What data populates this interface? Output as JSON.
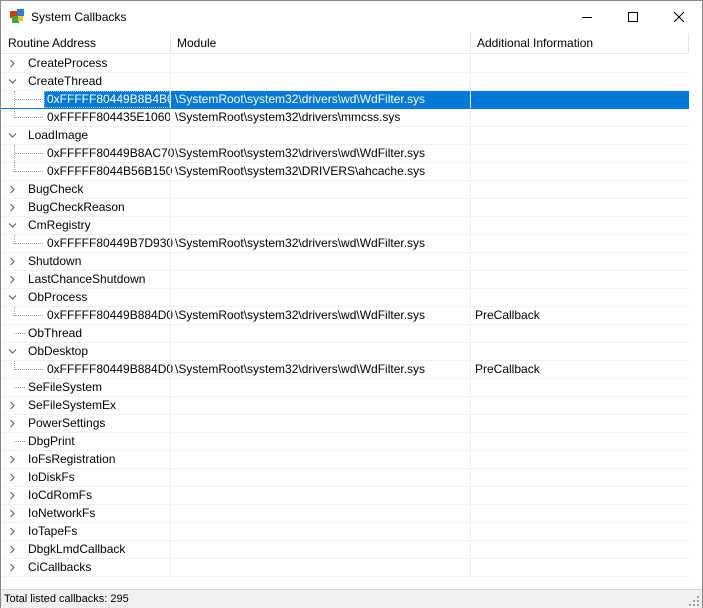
{
  "window": {
    "title": "System Callbacks"
  },
  "columns": [
    "Routine Address",
    "Module",
    "Additional Information"
  ],
  "rows": [
    {
      "kind": "parent",
      "expanded": false,
      "name": "CreateProcess",
      "module": "",
      "info": ""
    },
    {
      "kind": "parent",
      "expanded": true,
      "name": "CreateThread",
      "module": "",
      "info": ""
    },
    {
      "kind": "child",
      "selected": true,
      "name": "0xFFFFF80449B8B4B0",
      "module": "\\SystemRoot\\system32\\drivers\\wd\\WdFilter.sys",
      "info": ""
    },
    {
      "kind": "child",
      "last": true,
      "name": "0xFFFFF804435E1060",
      "module": "\\SystemRoot\\system32\\drivers\\mmcss.sys",
      "info": ""
    },
    {
      "kind": "parent",
      "expanded": true,
      "name": "LoadImage",
      "module": "",
      "info": ""
    },
    {
      "kind": "child",
      "name": "0xFFFFF80449B8AC70",
      "module": "\\SystemRoot\\system32\\drivers\\wd\\WdFilter.sys",
      "info": ""
    },
    {
      "kind": "child",
      "last": true,
      "name": "0xFFFFF8044B56B150",
      "module": "\\SystemRoot\\system32\\DRIVERS\\ahcache.sys",
      "info": ""
    },
    {
      "kind": "parent",
      "expanded": false,
      "name": "BugCheck",
      "module": "",
      "info": ""
    },
    {
      "kind": "parent",
      "expanded": false,
      "name": "BugCheckReason",
      "module": "",
      "info": ""
    },
    {
      "kind": "parent",
      "expanded": true,
      "name": "CmRegistry",
      "module": "",
      "info": ""
    },
    {
      "kind": "child",
      "last": true,
      "name": "0xFFFFF80449B7D930",
      "module": "\\SystemRoot\\system32\\drivers\\wd\\WdFilter.sys",
      "info": ""
    },
    {
      "kind": "parent",
      "expanded": false,
      "name": "Shutdown",
      "module": "",
      "info": ""
    },
    {
      "kind": "parent",
      "expanded": false,
      "name": "LastChanceShutdown",
      "module": "",
      "info": ""
    },
    {
      "kind": "parent",
      "expanded": true,
      "name": "ObProcess",
      "module": "",
      "info": ""
    },
    {
      "kind": "child",
      "last": true,
      "name": "0xFFFFF80449B884D0",
      "module": "\\SystemRoot\\system32\\drivers\\wd\\WdFilter.sys",
      "info": "PreCallback"
    },
    {
      "kind": "parent",
      "expanded": null,
      "name": "ObThread",
      "module": "",
      "info": ""
    },
    {
      "kind": "parent",
      "expanded": true,
      "name": "ObDesktop",
      "module": "",
      "info": ""
    },
    {
      "kind": "child",
      "last": true,
      "name": "0xFFFFF80449B884D0",
      "module": "\\SystemRoot\\system32\\drivers\\wd\\WdFilter.sys",
      "info": "PreCallback"
    },
    {
      "kind": "parent",
      "expanded": null,
      "name": "SeFileSystem",
      "module": "",
      "info": ""
    },
    {
      "kind": "parent",
      "expanded": false,
      "name": "SeFileSystemEx",
      "module": "",
      "info": ""
    },
    {
      "kind": "parent",
      "expanded": false,
      "name": "PowerSettings",
      "module": "",
      "info": ""
    },
    {
      "kind": "parent",
      "expanded": null,
      "name": "DbgPrint",
      "module": "",
      "info": ""
    },
    {
      "kind": "parent",
      "expanded": false,
      "name": "IoFsRegistration",
      "module": "",
      "info": ""
    },
    {
      "kind": "parent",
      "expanded": false,
      "name": "IoDiskFs",
      "module": "",
      "info": ""
    },
    {
      "kind": "parent",
      "expanded": false,
      "name": "IoCdRomFs",
      "module": "",
      "info": ""
    },
    {
      "kind": "parent",
      "expanded": false,
      "name": "IoNetworkFs",
      "module": "",
      "info": ""
    },
    {
      "kind": "parent",
      "expanded": false,
      "name": "IoTapeFs",
      "module": "",
      "info": ""
    },
    {
      "kind": "parent",
      "expanded": false,
      "name": "DbgkLmdCallback",
      "module": "",
      "info": ""
    },
    {
      "kind": "parent",
      "expanded": false,
      "name": "CiCallbacks",
      "module": "",
      "info": ""
    }
  ],
  "status": {
    "text": "Total listed callbacks: 295"
  },
  "colors": {
    "selection": "#0078d7",
    "grid": "#f0f0f0",
    "statusbar": "#f0f0f0"
  },
  "icons": {
    "app": "app-icon",
    "minimize": "minimize-icon",
    "maximize": "maximize-icon",
    "close": "close-icon"
  }
}
